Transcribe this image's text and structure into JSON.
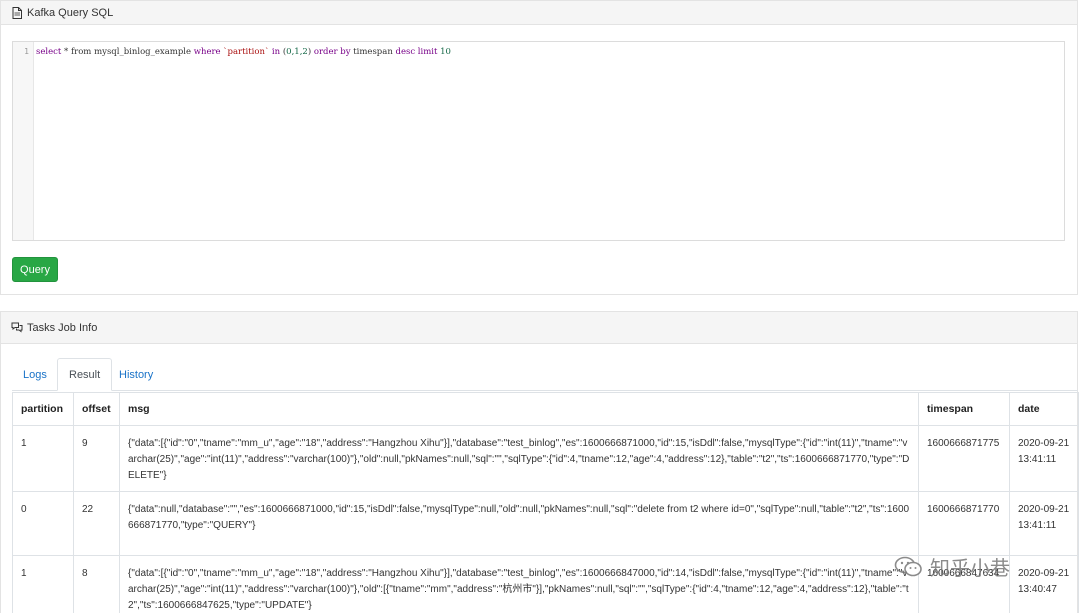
{
  "sql_panel": {
    "title": "Kafka Query SQL",
    "icon": "file-icon",
    "editor": {
      "line_number": "1",
      "tokens": {
        "select": "select",
        "star_from": " * from ",
        "table": "mysql_binlog_example",
        "where": " where ",
        "column": "`partition`",
        "in": " in ",
        "paren_open": "(",
        "values": "0,1,2",
        "paren_close": ")",
        "order_by": " order by ",
        "field": "timespan",
        "desc": " desc ",
        "limit": "limit",
        "limit_value": " 10"
      }
    },
    "query_button": "Query"
  },
  "job_panel": {
    "title": "Tasks Job Info",
    "icon": "comments-icon",
    "tabs": [
      {
        "label": "Logs",
        "active": false
      },
      {
        "label": "Result",
        "active": true
      },
      {
        "label": "History",
        "active": false
      }
    ],
    "table": {
      "columns": [
        "partition",
        "offset",
        "msg",
        "timespan",
        "date"
      ],
      "rows": [
        {
          "partition": "1",
          "offset": "9",
          "msg": "{\"data\":[{\"id\":\"0\",\"tname\":\"mm_u\",\"age\":\"18\",\"address\":\"Hangzhou Xihu\"}],\"database\":\"test_binlog\",\"es\":1600666871000,\"id\":15,\"isDdl\":false,\"mysqlType\":{\"id\":\"int(11)\",\"tname\":\"varchar(25)\",\"age\":\"int(11)\",\"address\":\"varchar(100)\"},\"old\":null,\"pkNames\":null,\"sql\":\"\",\"sqlType\":{\"id\":4,\"tname\":12,\"age\":4,\"address\":12},\"table\":\"t2\",\"ts\":1600666871770,\"type\":\"DELETE\"}",
          "timespan": "1600666871775",
          "date": "2020-09-21 13:41:11"
        },
        {
          "partition": "0",
          "offset": "22",
          "msg": "{\"data\":null,\"database\":\"\",\"es\":1600666871000,\"id\":15,\"isDdl\":false,\"mysqlType\":null,\"old\":null,\"pkNames\":null,\"sql\":\"delete from t2 where id=0\",\"sqlType\":null,\"table\":\"t2\",\"ts\":1600666871770,\"type\":\"QUERY\"}",
          "timespan": "1600666871770",
          "date": "2020-09-21 13:41:11"
        },
        {
          "partition": "1",
          "offset": "8",
          "msg": "{\"data\":[{\"id\":\"0\",\"tname\":\"mm_u\",\"age\":\"18\",\"address\":\"Hangzhou Xihu\"}],\"database\":\"test_binlog\",\"es\":1600666847000,\"id\":14,\"isDdl\":false,\"mysqlType\":{\"id\":\"int(11)\",\"tname\":\"varchar(25)\",\"age\":\"int(11)\",\"address\":\"varchar(100)\"},\"old\":[{\"tname\":\"mm\",\"address\":\"杭州市\"}],\"pkNames\":null,\"sql\":\"\",\"sqlType\":{\"id\":4,\"tname\":12,\"age\":4,\"address\":12},\"table\":\"t2\",\"ts\":1600666847625,\"type\":\"UPDATE\"}",
          "timespan": "1600666847634",
          "date": "2020-09-21 13:40:47"
        }
      ]
    }
  },
  "watermark": {
    "icon": "wechat-icon",
    "text": "知乎小巷"
  },
  "colors": {
    "primary_button": "#28a745",
    "link": "#1a73c8",
    "keyword": "#770088",
    "string": "#aa1111",
    "number": "#116644"
  }
}
